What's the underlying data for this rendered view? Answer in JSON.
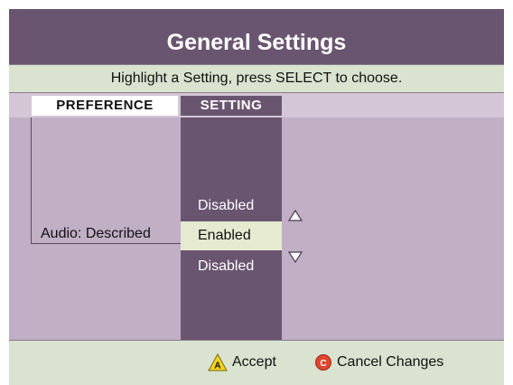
{
  "title": "General Settings",
  "instruction": "Highlight a Setting, press SELECT to choose.",
  "headers": {
    "preference": "PREFERENCE",
    "setting": "SETTING"
  },
  "preference_item": "Audio: Described",
  "setting_options": [
    "Disabled",
    "Enabled",
    "Disabled"
  ],
  "selected_option_index": 1,
  "icons": {
    "up": "triangle-up-icon",
    "down": "triangle-down-icon",
    "a_button": "a-button-icon",
    "c_button": "c-button-icon"
  },
  "footer": {
    "accept_key": "A",
    "accept_label": "Accept",
    "cancel_key": "C",
    "cancel_label": "Cancel Changes"
  },
  "colors": {
    "title_bar": "#6a5570",
    "setting_column": "#6a5570",
    "content": "#c1afc6",
    "instruction_bar": "#d9e3d0",
    "selected_option": "#e5ead0",
    "a_button": "#f2d21e",
    "c_button": "#e0452f"
  }
}
